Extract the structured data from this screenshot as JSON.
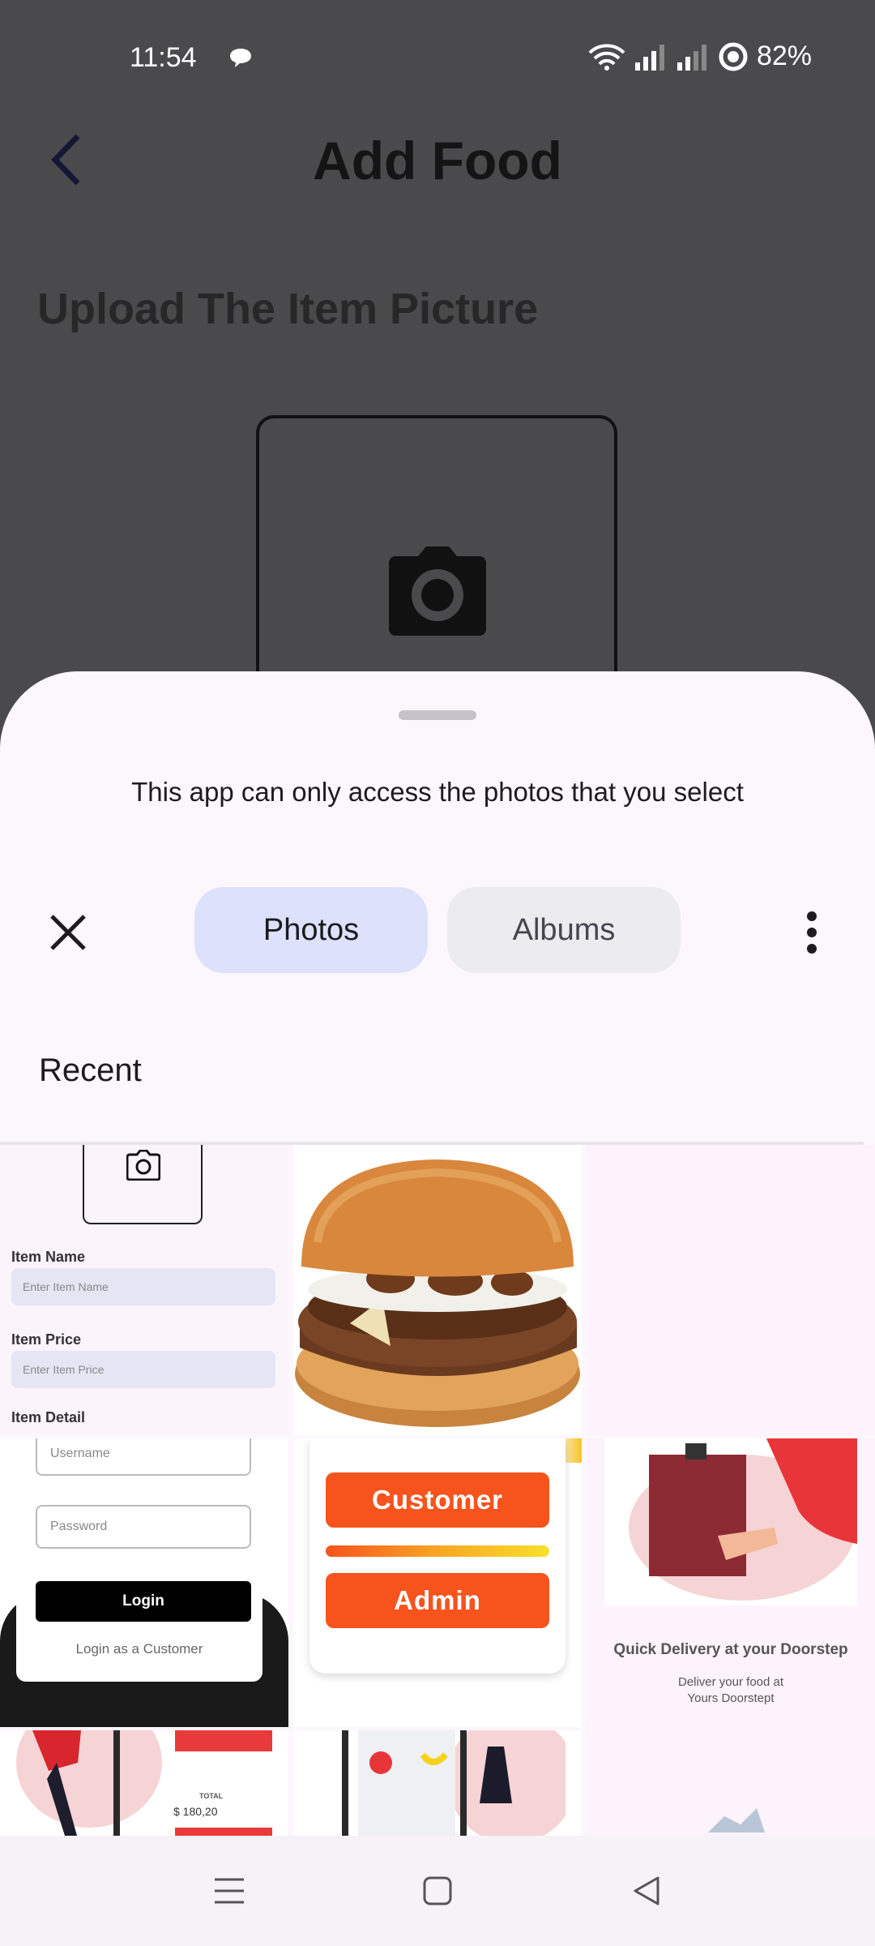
{
  "status_bar": {
    "time": "11:54",
    "battery": "82%"
  },
  "header": {
    "title": "Add Food",
    "subtitle": "Upload The Item Picture"
  },
  "picker": {
    "notice": "This app can only access the photos that you select",
    "tabs": {
      "photos": "Photos",
      "albums": "Albums"
    },
    "section_title": "Recent"
  },
  "thumbs": {
    "form": {
      "item_name_label": "Item Name",
      "item_name_placeholder": "Enter Item Name",
      "item_price_label": "Item Price",
      "item_price_placeholder": "Enter Item Price",
      "item_detail_label": "Item Detail"
    },
    "login": {
      "username": "Username",
      "password": "Password",
      "login_button": "Login",
      "customer_link": "Login as a Customer"
    },
    "roles": {
      "customer": "Customer",
      "admin": "Admin"
    },
    "delivery": {
      "title": "Quick Delivery at your Doorstep",
      "line1": "Deliver your food at",
      "line2": "Yours Doorstept"
    },
    "cart": {
      "total_label": "TOTAL",
      "total_value": "$ 180,20"
    }
  },
  "colors": {
    "accent_orange": "#f6531d",
    "selected_tab": "#dde1fb",
    "sheet_bg": "#fbf7fc"
  }
}
